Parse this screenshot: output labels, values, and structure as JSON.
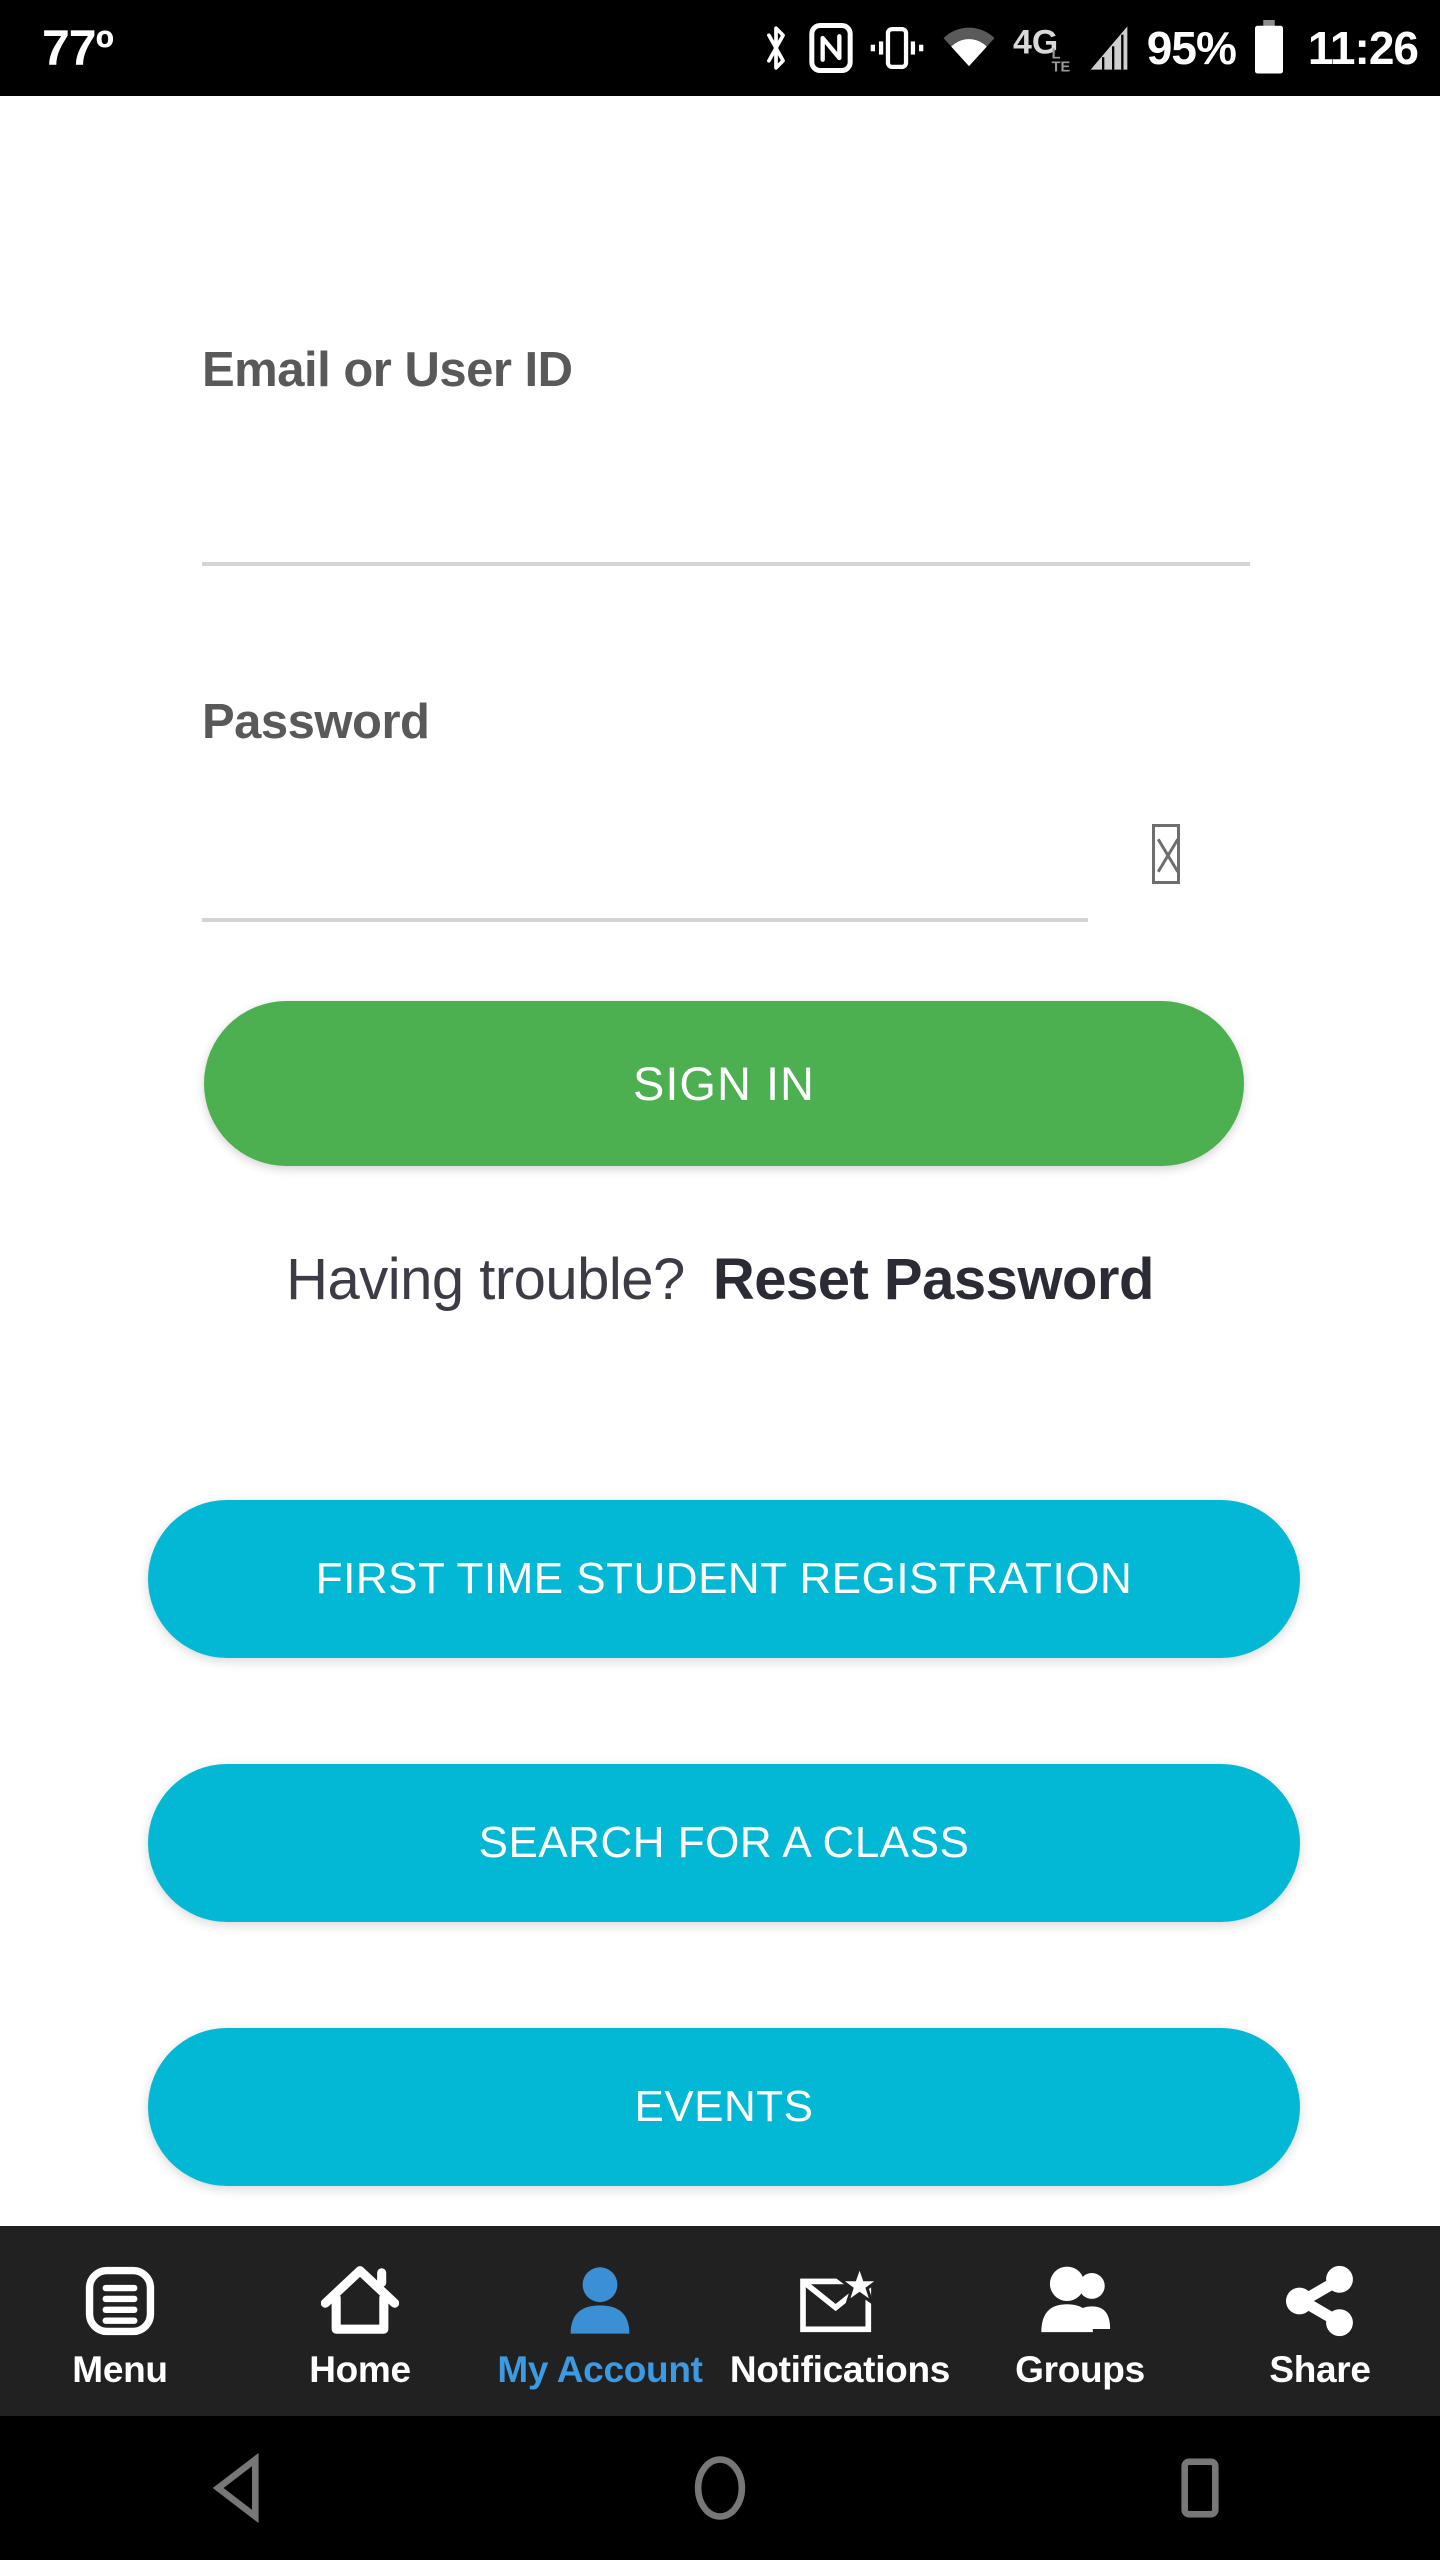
{
  "status_bar": {
    "temperature": "77º",
    "battery_percent": "95%",
    "time": "11:26",
    "network": "4G LTE",
    "icons": [
      "bluetooth-icon",
      "nfc-icon",
      "vibrate-icon",
      "wifi-icon",
      "network-4glte-icon",
      "signal-bars-icon",
      "battery-icon"
    ]
  },
  "login_form": {
    "email_label": "Email or User ID",
    "email_value": "",
    "email_placeholder": "",
    "password_label": "Password",
    "password_value": "",
    "password_placeholder": "",
    "reveal_icon": "missing-glyph-tofu-icon",
    "signin_label": "SIGN IN"
  },
  "help_row": {
    "question": "Having trouble?",
    "link_label": "Reset Password"
  },
  "actions": [
    {
      "label": "FIRST TIME STUDENT REGISTRATION"
    },
    {
      "label": "SEARCH FOR A CLASS"
    },
    {
      "label": "EVENTS"
    }
  ],
  "tabbar": {
    "items": [
      {
        "label": "Menu",
        "icon": "menu-list-icon",
        "active": false
      },
      {
        "label": "Home",
        "icon": "home-icon",
        "active": false
      },
      {
        "label": "My Account",
        "icon": "person-icon",
        "active": true
      },
      {
        "label": "Notifications",
        "icon": "envelope-star-icon",
        "active": false
      },
      {
        "label": "Groups",
        "icon": "people-group-icon",
        "active": false
      },
      {
        "label": "Share",
        "icon": "share-nodes-icon",
        "active": false
      }
    ]
  },
  "android_navbar": {
    "back": "back-triangle-icon",
    "home": "home-circle-icon",
    "recents": "recents-square-icon"
  },
  "colors": {
    "signin_green": "#4caf50",
    "action_cyan": "#03b8d4",
    "tab_active_blue": "#3b9ae1",
    "tabbar_bg": "#212121",
    "label_gray": "#595959",
    "underline_gray": "#d4d4d4"
  }
}
